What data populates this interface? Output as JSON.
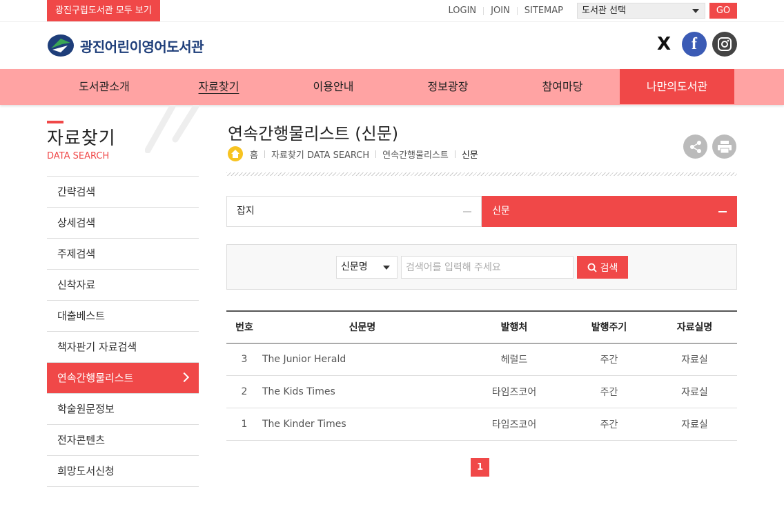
{
  "topbar": {
    "all_libs": "광진구립도서관 모두 보기",
    "links": [
      "LOGIN",
      "JOIN",
      "SITEMAP"
    ],
    "lib_select": "도서관 선택",
    "go": "GO"
  },
  "header": {
    "logo_text": "광진어린이영어도서관",
    "x_label": "X",
    "fb_label": "f"
  },
  "gnb": [
    "도서관소개",
    "자료찾기",
    "이용안내",
    "정보광장",
    "참여마당",
    "나만의도서관"
  ],
  "sidebar": {
    "title": "자료찾기",
    "subtitle": "DATA SEARCH",
    "items": [
      "간략검색",
      "상세검색",
      "주제검색",
      "신착자료",
      "대출베스트",
      "책자판기 자료검색",
      "연속간행물리스트",
      "학술원문정보",
      "전자콘텐츠",
      "희망도서신청"
    ]
  },
  "content": {
    "title": "연속간행물리스트 (신문)",
    "breadcrumb": [
      "홈",
      "자료찾기 DATA SEARCH",
      "연속간행물리스트",
      "신문"
    ],
    "tabs": [
      "잡지",
      "신문"
    ],
    "search": {
      "field": "신문명",
      "placeholder": "검색어를 입력해 주세요",
      "button": "검색"
    },
    "table": {
      "headers": [
        "번호",
        "신문명",
        "발행처",
        "발행주기",
        "자료실명"
      ],
      "rows": [
        [
          "3",
          "The Junior Herald",
          "헤럴드",
          "주간",
          "자료실"
        ],
        [
          "2",
          "The Kids Times",
          "타임즈코어",
          "주간",
          "자료실"
        ],
        [
          "1",
          "The Kinder Times",
          "타임즈코어",
          "주간",
          "자료실"
        ]
      ]
    },
    "page": "1"
  },
  "colors": {
    "accent": "#f04848",
    "nav_bg": "#ffa3a3",
    "logo_blue": "#1e3e7a"
  }
}
